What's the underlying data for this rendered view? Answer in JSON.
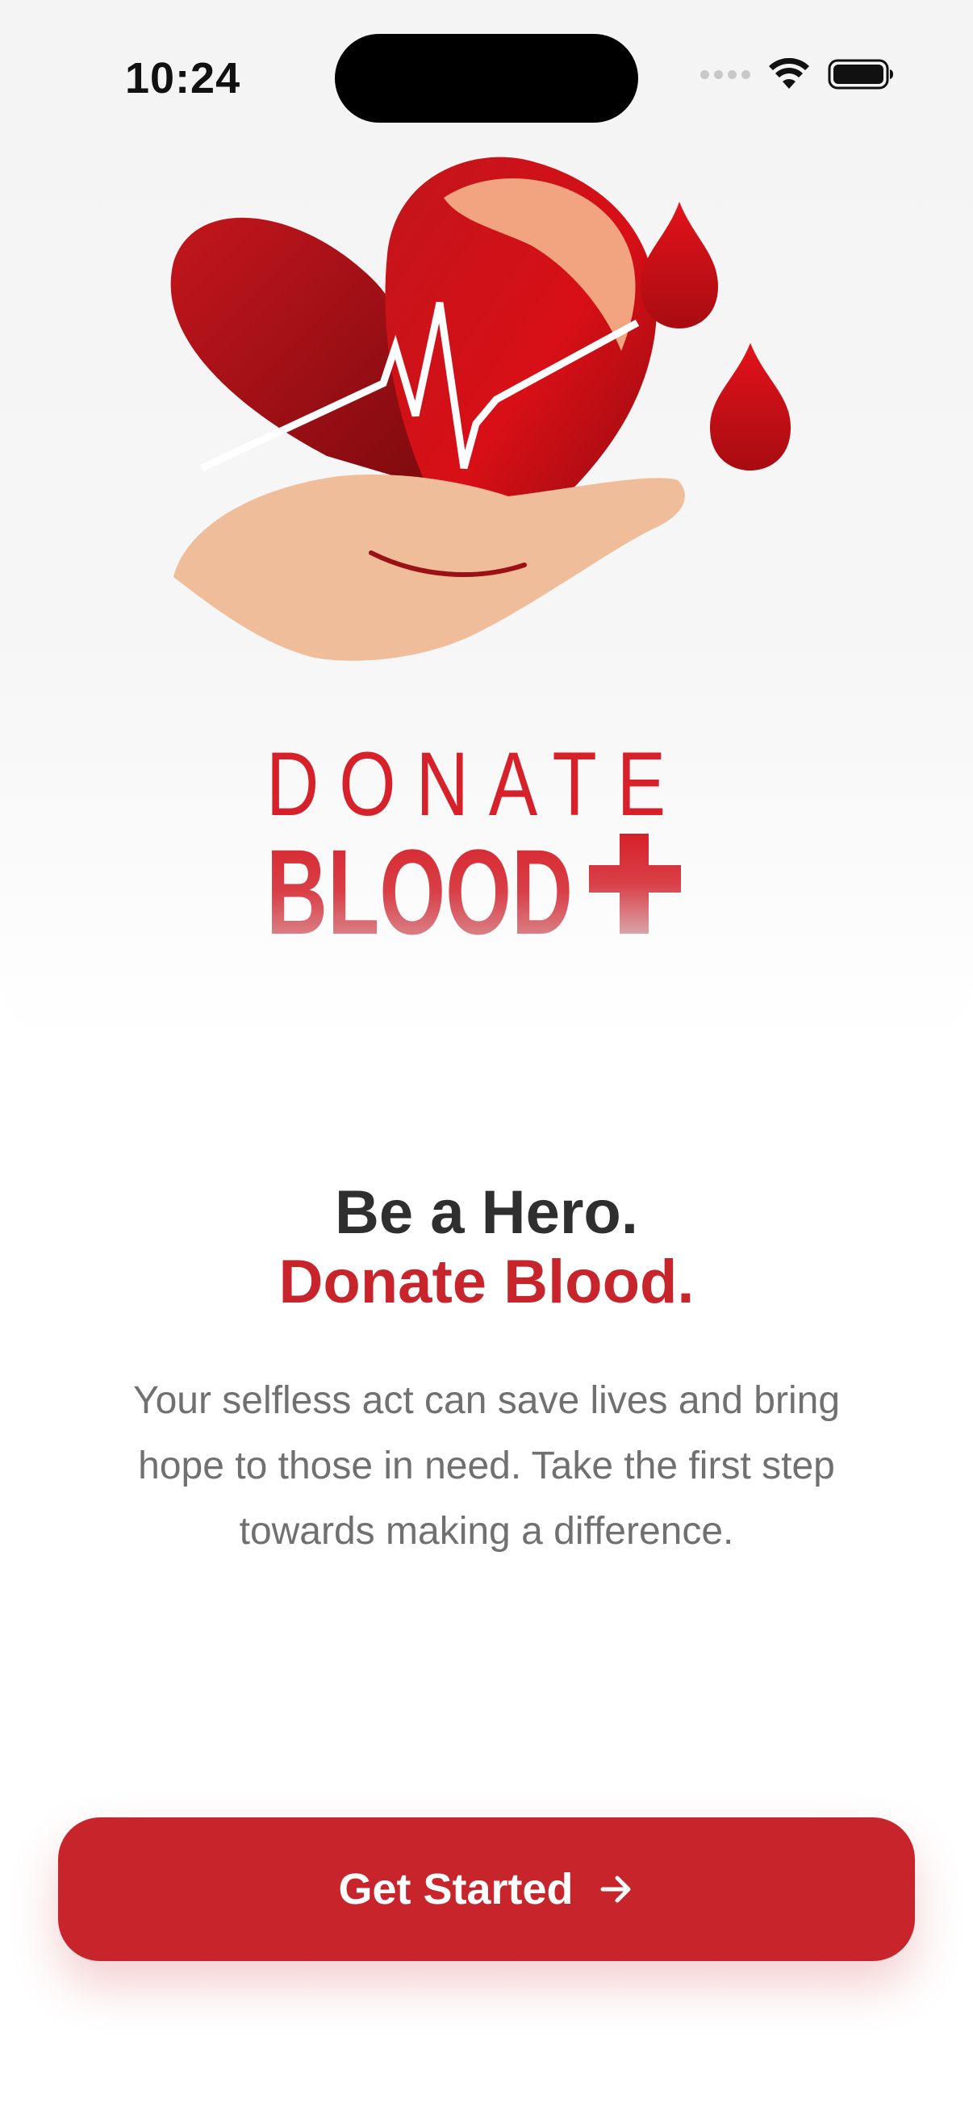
{
  "status_bar": {
    "time": "10:24"
  },
  "hero": {
    "logo_line1": "DONATE",
    "logo_line2": "BLOOD"
  },
  "headline": {
    "line1": "Be a Hero.",
    "line2": "Donate Blood."
  },
  "description": {
    "line1": "Your selfless act can save lives and bring",
    "line2": "hope to those in need. Take the first step",
    "line3": "towards making a difference."
  },
  "cta": {
    "label": "Get Started",
    "icon": "arrow-right-icon"
  },
  "colors": {
    "accent": "#c8242b",
    "headline_dark": "#2f2f2f",
    "body_text": "#707070"
  }
}
